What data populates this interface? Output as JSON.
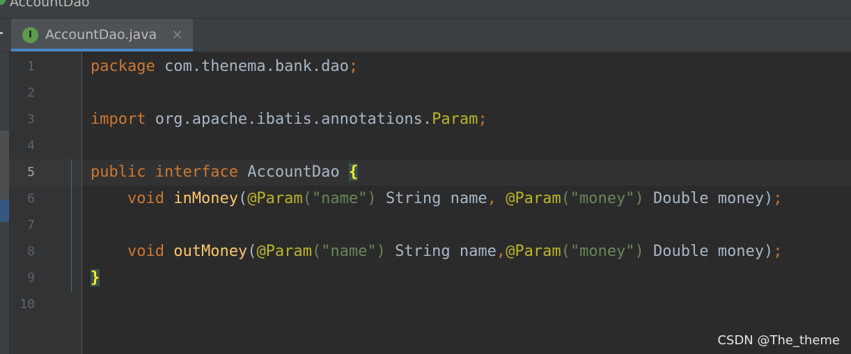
{
  "breadcrumb": {
    "label": "AccountDao"
  },
  "tab": {
    "label": "AccountDao.java",
    "icon": "interface-icon",
    "icon_glyph": "I",
    "close_glyph": "✕"
  },
  "gutter": {
    "line_numbers": [
      "1",
      "2",
      "3",
      "4",
      "5",
      "6",
      "7",
      "8",
      "9",
      "10"
    ],
    "active_line": 5
  },
  "code": {
    "l1": {
      "kw": "package",
      "rest": " com.thenema.bank.dao",
      "semi": ";"
    },
    "l3": {
      "kw": "import",
      "rest": " org.apache.ibatis.annotations.",
      "cls": "Param",
      "semi": ";"
    },
    "l5": {
      "kw1": "public",
      "kw2": "interface",
      "name": " AccountDao ",
      "brace": "{"
    },
    "l6": {
      "indent": "    ",
      "kw": "void",
      "method": "inMoney",
      "open": "(",
      "ann1": "@Param",
      "s1": "(\"name\")",
      "p1": " String name",
      "comma": ",",
      "ann2": " @Param",
      "s2": "(\"money\")",
      "p2": " Double money)",
      "semi": ";"
    },
    "l8": {
      "indent": "    ",
      "kw": "void",
      "method": "outMoney",
      "open": "(",
      "ann1": "@Param",
      "s1": "(\"name\")",
      "p1": " String name",
      "comma": ",",
      "ann2": "@Param",
      "s2": "(\"money\")",
      "p2": " Double money)",
      "semi": ";"
    },
    "l9": {
      "brace": "}"
    }
  },
  "watermark": "CSDN @The_theme",
  "colors": {
    "background": "#2b2b2b",
    "keyword": "#cc7832",
    "annotation": "#bbb529",
    "string": "#6a8759",
    "method": "#ffc66d",
    "text": "#a9b7c6",
    "tab_underline": "#4a88c7"
  }
}
